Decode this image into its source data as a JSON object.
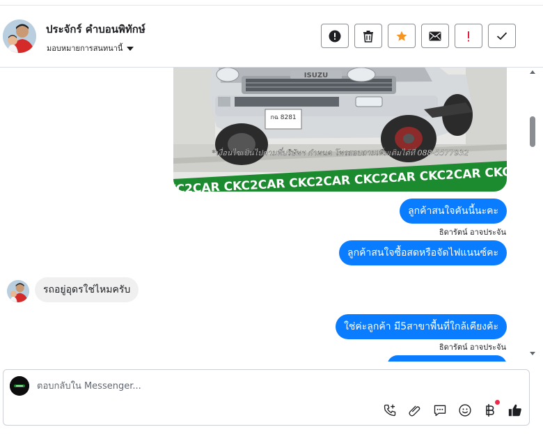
{
  "header": {
    "contact_name": "ประจักร์ คำบอนพิทักษ์",
    "assign_label": "มอบหมายการสนทนานี้",
    "actions": [
      {
        "name": "mark-spam-button",
        "icon": "alert-circle-icon"
      },
      {
        "name": "delete-button",
        "icon": "trash-icon"
      },
      {
        "name": "star-button",
        "icon": "star-icon",
        "color": "#f7931e"
      },
      {
        "name": "mark-unread-button",
        "icon": "envelope-icon"
      },
      {
        "name": "follow-up-button",
        "icon": "exclamation-icon",
        "color": "#e41e3f"
      },
      {
        "name": "mark-done-button",
        "icon": "check-icon"
      }
    ]
  },
  "chat": {
    "image": {
      "plate": "กฉ 8281",
      "caption": "*เงื่อนไขเป็นไปตามที่บริษัทฯ กำหนด โทรสอบถามเพิ่มเติมได้ที่ 088-5577932",
      "banner": "CKC2CAR CKC2CAR CKC2CAR CKC2CAR CKC2CAR CKC2",
      "brand": "ISUZU"
    },
    "messages": [
      {
        "text": "ลูกค้าสนใจคันนี้นะคะ",
        "sender": "ธิดารัตน์ อาจประจัน"
      },
      {
        "text": "ลูกค้าสนใจซื้อสดหรือจัดไฟแนนซ์คะ"
      },
      {
        "text": "รถอยู่อุดรใช่ไหมครับ"
      },
      {
        "text": "ใช่ค่ะลูกค้า มี5สาขาพื้นที่ใกล้เคียงค้ะ",
        "sender": "ธิดารัตน์ อาจประจัน"
      }
    ]
  },
  "composer": {
    "placeholder": "ตอบกลับใน Messenger...",
    "tools": [
      "phone-add-icon",
      "paperclip-icon",
      "saved-reply-icon",
      "emoji-icon",
      "baht-icon",
      "thumbs-up-icon"
    ]
  },
  "colors": {
    "accent": "#0a7cff",
    "incoming_bubble": "#f0f0f0",
    "banner_green": "#1c8a2e",
    "notification": "#f02849"
  }
}
